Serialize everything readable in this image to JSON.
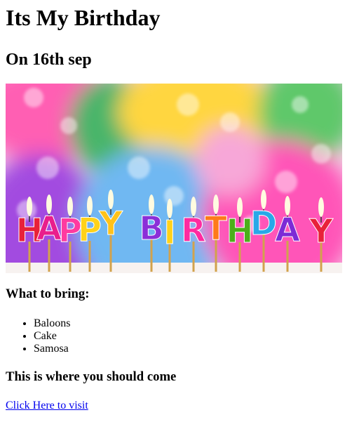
{
  "page": {
    "title": "Its My Birthday",
    "subtitle": "On 16th sep",
    "image": {
      "letters": [
        "H",
        "A",
        "P",
        "P",
        "Y",
        "B",
        "I",
        "R",
        "T",
        "H",
        "D",
        "A",
        "Y"
      ],
      "letter_colors": [
        "#e8213a",
        "#e91e8c",
        "#ff3aa0",
        "#ffd21a",
        "#ffc21a",
        "#8b2fd8",
        "#ffd21a",
        "#ff2aa0",
        "#ff7a1a",
        "#4caf1a",
        "#29a8e8",
        "#7d2bd6",
        "#e8213a"
      ]
    },
    "bring_heading": "What to bring:",
    "bring_items": [
      "Baloons",
      "Cake",
      "Samosa"
    ],
    "where_heading": "This is where you should come",
    "link_text": "Click Here to visit"
  }
}
